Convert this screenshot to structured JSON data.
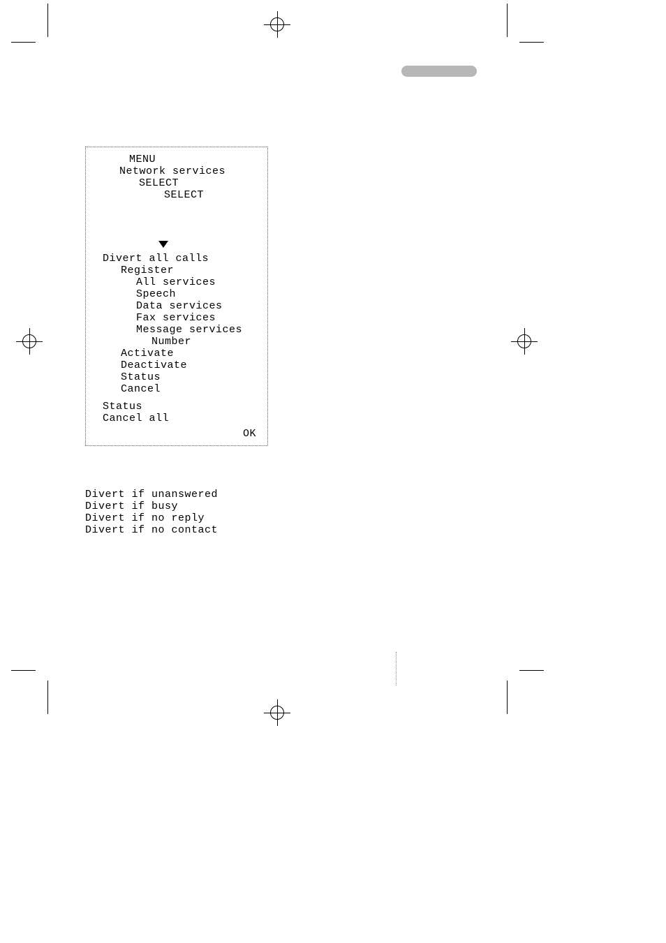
{
  "menu": {
    "title": "MENU",
    "network_services": "Network services",
    "select1": "SELECT",
    "select2": "SELECT",
    "divert_all": "Divert all calls",
    "register": "Register",
    "services": {
      "all": "All services",
      "speech": "Speech",
      "data": "Data services",
      "fax": "Fax services",
      "message": "Message services",
      "number": "Number"
    },
    "activate": "Activate",
    "deactivate": "Deactivate",
    "status": "Status",
    "cancel": "Cancel",
    "status2": "Status",
    "cancel_all": "Cancel all",
    "ok": "OK"
  },
  "diverts": {
    "unanswered": "Divert if unanswered",
    "busy": "Divert if busy",
    "no_reply": "Divert if no reply",
    "no_contact": "Divert if no contact"
  }
}
